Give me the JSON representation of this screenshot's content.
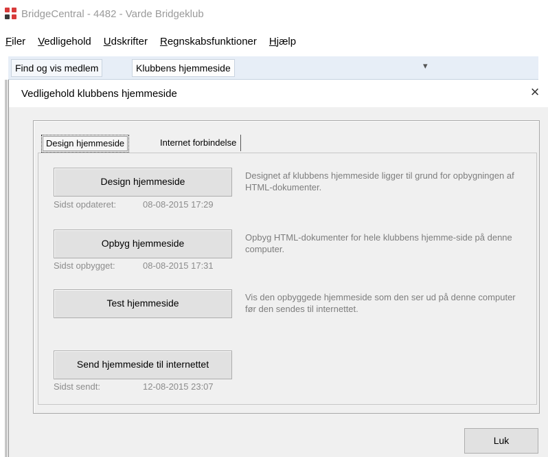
{
  "window": {
    "title": "BridgeCentral - 4482 - Varde Bridgeklub"
  },
  "menu": {
    "items": [
      {
        "underline": "F",
        "rest": "iler"
      },
      {
        "underline": "V",
        "rest": "edligehold"
      },
      {
        "underline": "U",
        "rest": "dskrifter"
      },
      {
        "underline": "R",
        "rest": "egnskabsfunktioner"
      },
      {
        "underline": "H",
        "rest": "jælp"
      }
    ]
  },
  "quickbar": {
    "tabs": [
      "Find og vis medlem",
      "Klubbens hjemmeside"
    ],
    "overflow_icon": "chevron-down-icon"
  },
  "dialog": {
    "title": "Vedligehold klubbens hjemmeside",
    "close": "×",
    "tabs": [
      "Design hjemmeside",
      "Internet forbindelse"
    ],
    "actions": [
      {
        "button": "Design hjemmeside",
        "meta_label": "Sidst opdateret:",
        "meta_value": "08-08-2015 17:29",
        "description": "Designet af klubbens hjemmeside ligger til grund for opbygningen af HTML-dokumenter."
      },
      {
        "button": "Opbyg hjemmeside",
        "meta_label": "Sidst opbygget:",
        "meta_value": "08-08-2015 17:31",
        "description": "Opbyg HTML-dokumenter for hele klubbens hjemme-side på denne computer."
      },
      {
        "button": "Test hjemmeside",
        "meta_label": "",
        "meta_value": "",
        "description": "Vis den opbyggede hjemmeside som den ser ud på denne computer før den sendes til internettet."
      },
      {
        "button": "Send hjemmeside til internettet",
        "meta_label": "Sidst sendt:",
        "meta_value": "12-08-2015 23:07",
        "description": ""
      }
    ],
    "close_button": "Luk"
  },
  "colors": {
    "logo_red": "#d83b3b",
    "logo_dark": "#3a3a3a",
    "dialog_bg": "#f0f0f0",
    "quickbar_bg": "#e7eef7"
  }
}
